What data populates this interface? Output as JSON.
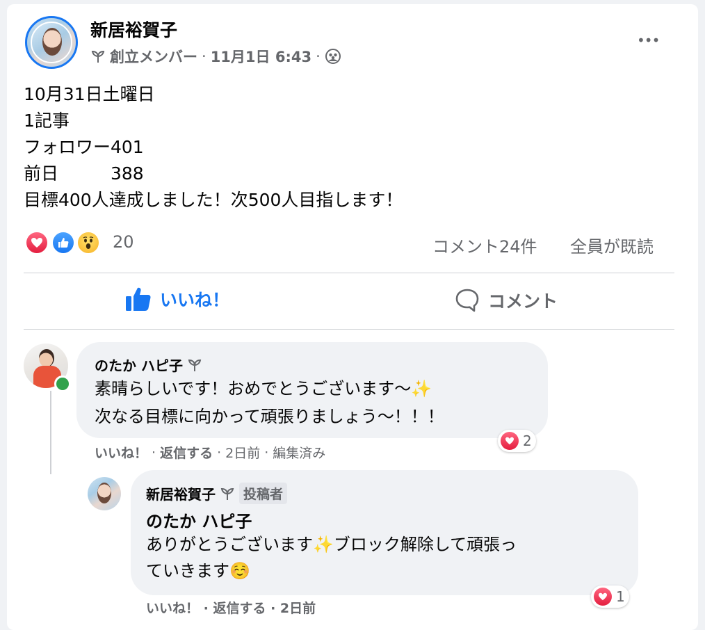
{
  "post": {
    "author": "新居裕賀子",
    "badge": "創立メンバー",
    "sep1": "·",
    "date": "11月1日 6:43",
    "sep2": "·",
    "more": "•••",
    "lines": [
      "10月31日土曜日",
      "1記事",
      "フォロワー401",
      "前日　　　388",
      "目標400人達成しました！次500人目指します！"
    ],
    "reaction_count": "20",
    "comment_count": "コメント24件",
    "seen": "全員が既読"
  },
  "actions": {
    "like": "いいね！",
    "comment": "コメント"
  },
  "comments": [
    {
      "author": "のたか ハピ子",
      "lines": [
        "素晴らしいです！おめでとうございます〜✨",
        "次なる目標に向かって頑張りましょう〜！！！"
      ],
      "like": "いいね！",
      "sep1": "·",
      "reply": "返信する",
      "sep2": "·",
      "time": "2日前",
      "sep3": "·",
      "edited": "編集済み",
      "reaction_count": "2"
    },
    {
      "author": "新居裕賀子",
      "role": "投稿者",
      "mention": "のたか ハピ子",
      "lines": [
        "ありがとうございます✨ブロック解除して頑張っ",
        "ていきます☺️"
      ],
      "footer": "いいね！ · 返信する · 2日前",
      "reaction_count": "1"
    }
  ],
  "colors": {
    "blue": "#1877f2",
    "gray_text": "#65676b",
    "bubble": "#f0f2f5",
    "heart": "#f33e58",
    "online": "#31a24c"
  }
}
